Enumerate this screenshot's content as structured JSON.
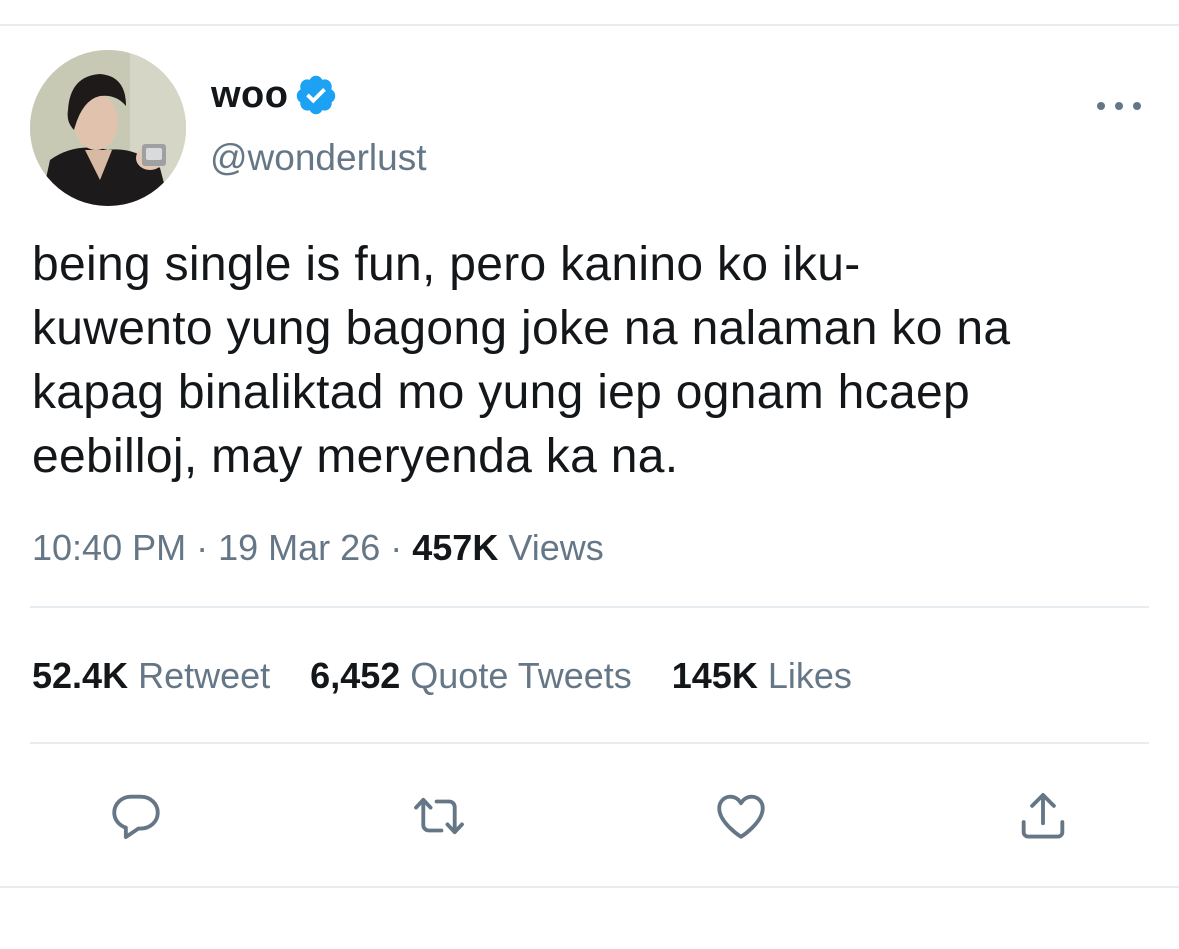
{
  "author": {
    "display_name": "woo",
    "handle": "@wonderlust",
    "verified_icon": "verified-badge-icon",
    "avatar_icon": "profile-photo"
  },
  "tweet": {
    "text_lines": [
      "being single is fun, pero kanino ko iku-",
      "kuwento yung bagong joke na nalaman ko na",
      "kapag binaliktad mo yung iep ognam hcaep",
      "eebilloj, may meryenda ka na."
    ],
    "time": "10:40 PM",
    "sep1": "·",
    "date": "19 Mar 26",
    "sep2": "·",
    "views_count": "457K",
    "views_label": "Views"
  },
  "stats": {
    "retweets_count": "52.4K",
    "retweets_label": "Retweet",
    "quotes_count": "6,452",
    "quotes_label": "Quote Tweets",
    "likes_count": "145K",
    "likes_label": "Likes"
  },
  "actions": {
    "reply_icon": "reply-icon",
    "retweet_icon": "retweet-icon",
    "like_icon": "like-icon",
    "share_icon": "share-icon"
  },
  "colors": {
    "text_primary": "#14171a",
    "text_secondary": "#657786",
    "divider": "#e6ecf0",
    "verified_blue": "#1da1f2"
  }
}
